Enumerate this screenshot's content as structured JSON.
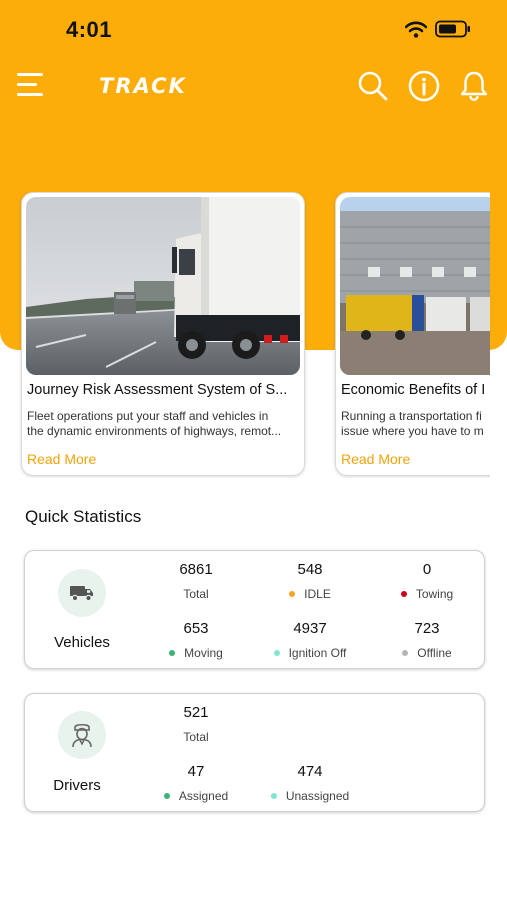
{
  "status": {
    "time": "4:01"
  },
  "app": {
    "logo_text": "TRACK"
  },
  "icons": {
    "menu": "menu-icon",
    "search": "search-icon",
    "info": "info-icon",
    "bell": "bell-icon"
  },
  "colors": {
    "brand": "#FCAD0A",
    "link": "#F0A30A",
    "idle": "#F5A623",
    "towing": "#D0021B",
    "moving": "#3CB371",
    "ignition_off": "#7FE5D4",
    "offline": "#B5B5B5",
    "assigned": "#3CB371",
    "unassigned": "#7FE5D4"
  },
  "articles": [
    {
      "title": "Journey Risk Assessment System of S...",
      "desc_line1": "Fleet operations put your staff and vehicles in",
      "desc_line2": "the dynamic environments of highways, remot...",
      "link": "Read More"
    },
    {
      "title": "Economic Benefits of I",
      "desc_line1": "Running a transportation fi",
      "desc_line2": "issue where you have to m",
      "link": "Read More"
    }
  ],
  "quick_stats": {
    "title": "Quick Statistics",
    "vehicles": {
      "label": "Vehicles",
      "total": {
        "value": "6861",
        "label": "Total"
      },
      "idle": {
        "value": "548",
        "label": "IDLE"
      },
      "towing": {
        "value": "0",
        "label": "Towing"
      },
      "moving": {
        "value": "653",
        "label": "Moving"
      },
      "ignition_off": {
        "value": "4937",
        "label": "Ignition Off"
      },
      "offline": {
        "value": "723",
        "label": "Offline"
      }
    },
    "drivers": {
      "label": "Drivers",
      "total": {
        "value": "521",
        "label": "Total"
      },
      "assigned": {
        "value": "47",
        "label": "Assigned"
      },
      "unassigned": {
        "value": "474",
        "label": "Unassigned"
      }
    }
  }
}
